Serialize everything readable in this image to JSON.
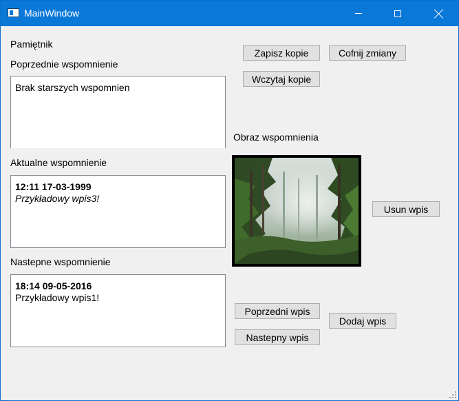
{
  "window": {
    "title": "MainWindow",
    "accent_color": "#0a78d7"
  },
  "left": {
    "app_label": "Pamiętnik",
    "previous": {
      "heading": "Poprzednie wspomnienie",
      "text": "Brak starszych wspomnien"
    },
    "current": {
      "heading": "Aktualne wspomnienie",
      "date": "12:11 17-03-1999",
      "text": "Przykładowy wpis3!"
    },
    "next": {
      "heading": "Nastepne wspomnienie",
      "date": "18:14 09-05-2016",
      "text": "Przykładowy wpis1!"
    }
  },
  "buttons": {
    "save_copy": "Zapisz kopie",
    "undo_changes": "Cofnij zmiany",
    "load_copy": "Wczytaj kopie",
    "delete_entry": "Usun wpis",
    "previous_entry": "Poprzedni wpis",
    "next_entry": "Nastepny wpis",
    "add_entry": "Dodaj wpis"
  },
  "image_section": {
    "heading": "Obraz wspomnienia",
    "image_subject": "misty forest"
  },
  "icons": {
    "app": "window-app-icon",
    "minimize": "minimize-icon",
    "maximize": "maximize-icon",
    "close": "close-icon",
    "resize": "resize-grip-icon"
  }
}
